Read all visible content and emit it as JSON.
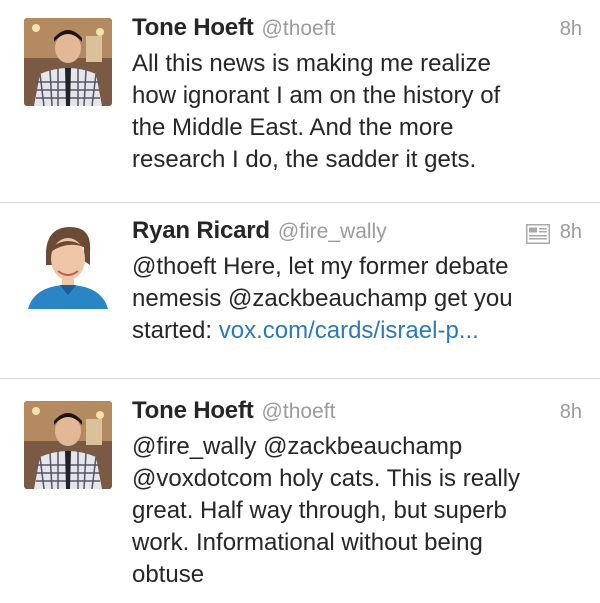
{
  "timeline": {
    "tweets": [
      {
        "name": "Tone Hoeft",
        "handle": "@thoeft",
        "time": "8h",
        "text": "All this news is making me realize\nhow ignorant I am on the history of\nthe Middle East. And the more\nresearch I do, the sadder it gets."
      },
      {
        "name": "Ryan Ricard",
        "handle": "@fire_wally",
        "time": "8h",
        "text_before": "@thoeft Here, let my former debate\nnemesis @zackbeauchamp get you\nstarted: ",
        "link": "vox.com/cards/israel-p..."
      },
      {
        "name": "Tone Hoeft",
        "handle": "@thoeft",
        "time": "8h",
        "text": "@fire_wally @zackbeauchamp\n@voxdotcom holy cats. This is really\ngreat. Half way through, but superb\nwork. Informational without being\nobtuse"
      }
    ]
  },
  "icons": {
    "card": "summary-card-icon"
  },
  "colors": {
    "name": "#262626",
    "secondary": "#9b9b9b",
    "link": "#2a7ab8",
    "divider": "#d9d9d9"
  }
}
